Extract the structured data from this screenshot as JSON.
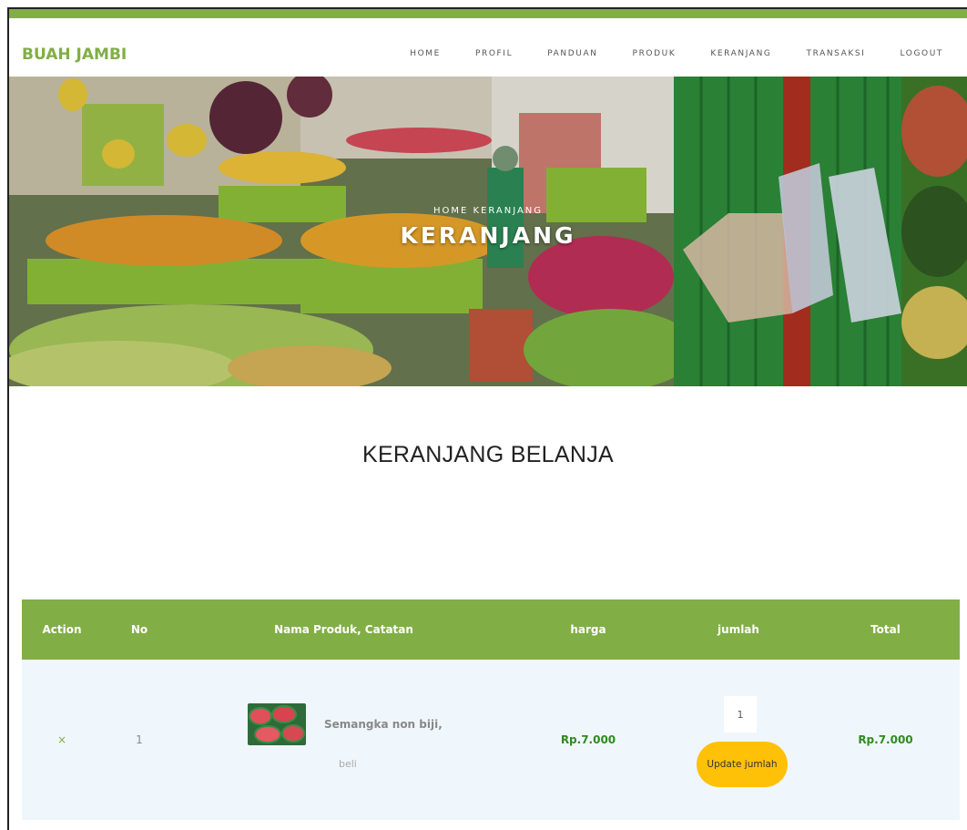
{
  "brand": "BUAH JAMBI",
  "nav": {
    "home": "HOME",
    "profil": "PROFIL",
    "panduan": "PANDUAN",
    "produk": "PRODUK",
    "keranjang": "KERANJANG",
    "transaksi": "TRANSAKSI",
    "logout": "LOGOUT"
  },
  "hero": {
    "breadcrumb": "HOME  KERANJANG",
    "title": "KERANJANG"
  },
  "page_heading": "KERANJANG BELANJA",
  "colors": {
    "accent": "#82ae46",
    "price": "#2e8b1e",
    "button": "#ffc107",
    "row_bg": "#f0f7fc"
  },
  "cart": {
    "headers": {
      "action": "Action",
      "no": "No",
      "product": "Nama Produk, Catatan",
      "price": "harga",
      "qty": "jumlah",
      "total": "Total"
    },
    "rows": [
      {
        "action": "×",
        "no": "1",
        "name": "Semangka non biji,",
        "note": "beli",
        "price": "Rp.7.000",
        "qty": "1",
        "update_label": "Update jumlah",
        "total": "Rp.7.000"
      }
    ]
  }
}
